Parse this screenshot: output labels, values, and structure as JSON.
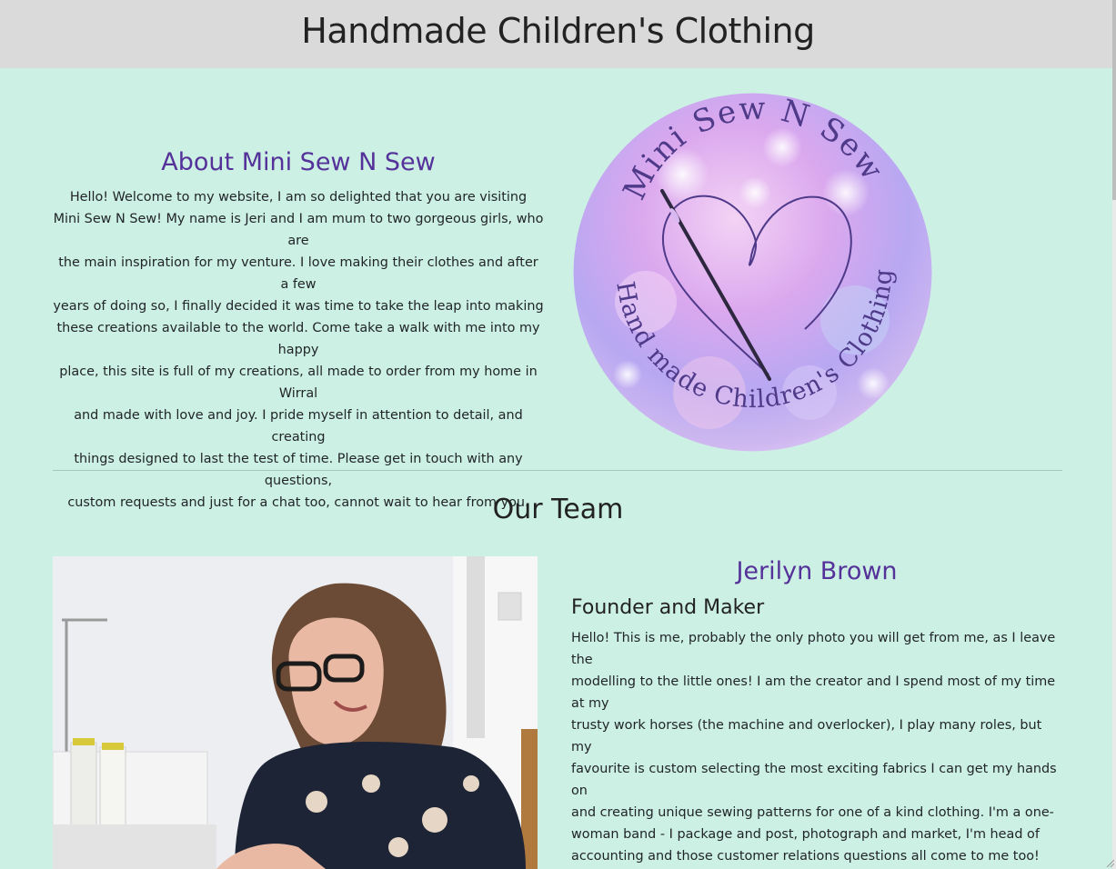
{
  "header": {
    "title": "Handmade Children's Clothing"
  },
  "about": {
    "title": "About Mini Sew N Sew",
    "lines": [
      "Hello! Welcome to my website, I am so delighted that you are visiting",
      "Mini Sew N Sew! My name is Jeri and I am mum to two gorgeous girls, who are",
      "the main inspiration for my venture. I love making their clothes and after a few",
      "years of doing so, I finally decided it was time to take the leap into making",
      "these creations available to the world. Come take a walk with me into my happy",
      "place, this site is full of my creations, all made to order from my home in Wirral",
      "and made with love and joy. I pride myself in attention to detail, and creating",
      "things designed to last the test of time. Please get in touch with any questions,",
      "custom requests and just for a chat too, cannot wait to hear from you."
    ]
  },
  "logo": {
    "top_text": "Mini Sew N Sew",
    "bottom_text": "Hand made Children's Clothing"
  },
  "team": {
    "title": "Our Team",
    "member": {
      "name": "Jerilyn Brown",
      "role": "Founder and Maker",
      "bio_lines": [
        "Hello! This is me, probably the only photo you will get from me, as I leave the",
        "modelling to the little ones! I am the creator and I spend most of my time at my",
        "trusty work horses (the machine and overlocker), I play many roles, but my",
        "favourite is custom selecting the most exciting fabrics I can get my hands on",
        "and creating unique sewing patterns for one of a kind clothing. I'm a one-",
        "woman band - I package and post, photograph and market, I'm head of",
        "accounting and those customer relations questions all come to me too!"
      ]
    }
  },
  "colors": {
    "page_background": "#ccf0e3",
    "header_background": "#dadada",
    "accent_purple": "#55319a",
    "text": "#212529"
  }
}
